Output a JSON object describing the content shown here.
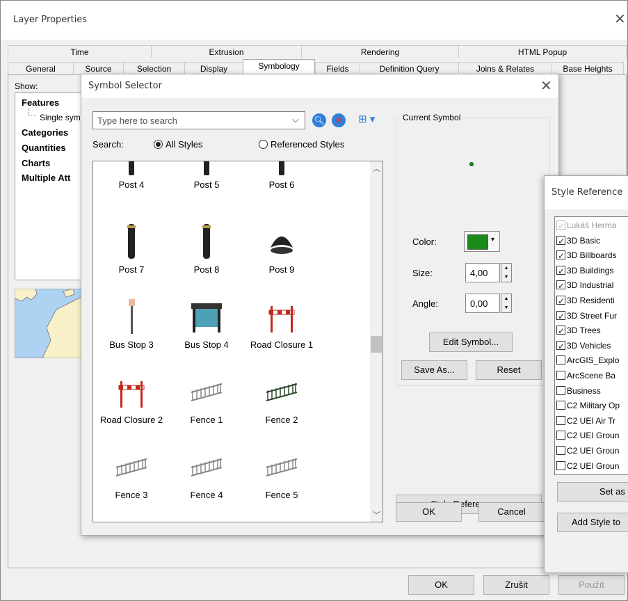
{
  "layer_props": {
    "title": "Layer Properties",
    "close": "✕",
    "tabs_row1": [
      "Time",
      "Extrusion",
      "Rendering",
      "HTML Popup"
    ],
    "tabs_row2": [
      "General",
      "Source",
      "Selection",
      "Display",
      "Symbology",
      "Fields",
      "Definition Query",
      "Joins & Relates",
      "Base Heights"
    ],
    "show_label": "Show:",
    "tree": {
      "features": "Features",
      "single": "Single sym",
      "categories": "Categories",
      "quantities": "Quantities",
      "charts": "Charts",
      "multiple": "Multiple Att"
    },
    "buttons": {
      "ok": "OK",
      "cancel": "Zrušit",
      "apply": "Použít"
    }
  },
  "symbol_selector": {
    "title": "Symbol Selector",
    "close": "✕",
    "search_placeholder": "Type here to search",
    "search_label": "Search:",
    "all_styles": "All Styles",
    "referenced_styles": "Referenced Styles",
    "gallery": [
      {
        "label": "Post 4",
        "icon": "post-icon"
      },
      {
        "label": "Post 5",
        "icon": "post-icon"
      },
      {
        "label": "Post 6",
        "icon": "post-icon"
      },
      {
        "label": "Post 7",
        "icon": "post-icon"
      },
      {
        "label": "Post 8",
        "icon": "post-icon"
      },
      {
        "label": "Post 9",
        "icon": "post-icon"
      },
      {
        "label": "Bus Stop 3",
        "icon": "bus-stop-icon"
      },
      {
        "label": "Bus Stop 4",
        "icon": "bus-stop-icon"
      },
      {
        "label": "Road Closure 1",
        "icon": "road-closure-icon"
      },
      {
        "label": "Road Closure 2",
        "icon": "road-closure-icon"
      },
      {
        "label": "Fence 1",
        "icon": "fence-icon"
      },
      {
        "label": "Fence 2",
        "icon": "fence-icon"
      },
      {
        "label": "Fence 3",
        "icon": "fence-icon"
      },
      {
        "label": "Fence 4",
        "icon": "fence-icon"
      },
      {
        "label": "Fence 5",
        "icon": "fence-icon"
      }
    ],
    "current_symbol_label": "Current Symbol",
    "symbol_color": "#1a8a1a",
    "color_label": "Color:",
    "size_label": "Size:",
    "size_value": "4,00",
    "angle_label": "Angle:",
    "angle_value": "0,00",
    "edit_symbol": "Edit Symbol...",
    "save_as": "Save As...",
    "reset": "Reset",
    "style_references": "Style References...",
    "ok": "OK",
    "cancel": "Cancel"
  },
  "style_refs": {
    "title": "Style Reference",
    "items": [
      {
        "label": "Lukáš Herma",
        "checked": true,
        "disabled": true
      },
      {
        "label": "3D Basic",
        "checked": true
      },
      {
        "label": "3D Billboards",
        "checked": true
      },
      {
        "label": "3D Buildings",
        "checked": true
      },
      {
        "label": "3D Industrial",
        "checked": true
      },
      {
        "label": "3D Residenti",
        "checked": true
      },
      {
        "label": "3D Street Fur",
        "checked": true
      },
      {
        "label": "3D Trees",
        "checked": true
      },
      {
        "label": "3D Vehicles",
        "checked": true
      },
      {
        "label": "ArcGIS_Explo",
        "checked": false
      },
      {
        "label": "ArcScene Ba",
        "checked": false
      },
      {
        "label": "Business",
        "checked": false
      },
      {
        "label": "C2 Military Op",
        "checked": false
      },
      {
        "label": "C2 UEI Air Tr",
        "checked": false
      },
      {
        "label": "C2 UEI Groun",
        "checked": false
      },
      {
        "label": "C2 UEI Groun",
        "checked": false
      },
      {
        "label": "C2 UEI Groun",
        "checked": false
      }
    ],
    "set_as": "Set as",
    "add_style": "Add Style to"
  }
}
